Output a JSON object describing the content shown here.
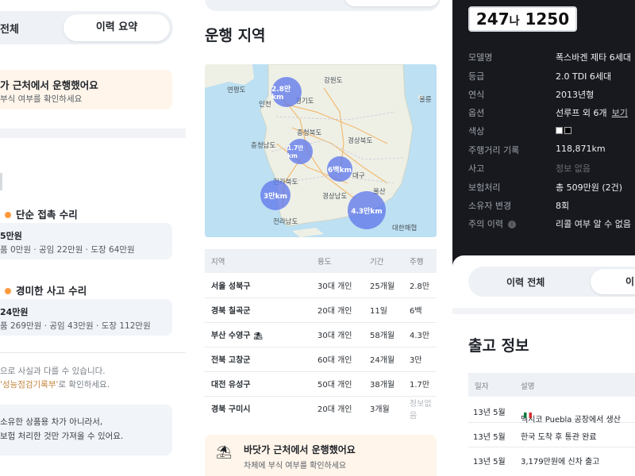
{
  "history_panel": {
    "tab_all": "전체",
    "tab_summary": "이력 요약",
    "notice_title": "가 근처에서 운행했어요",
    "notice_sub": "부식 여부를 확인하세요",
    "repairs": [
      {
        "title": "단순 접촉 수리",
        "amount": "5만원",
        "detail": "품 0만원 · 공임 22만원 · 도장 64만원"
      },
      {
        "title": "경미한 사고 수리",
        "amount": "24만원",
        "detail": "품 269만원 · 공임 43만원 · 도장 112만원"
      }
    ],
    "disclaimer_1": "으로 사실과 다를 수 있습니다.",
    "disclaimer_2_prefix": "",
    "disclaimer_2_link": "'성능점검기록부'",
    "disclaimer_2_suffix": "로 확인하세요.",
    "note_1": "소유한 상품용 차가 아니라서,",
    "note_2": "보험 처리한 것만 가져올 수 있어요."
  },
  "region_panel": {
    "title": "운행 지역",
    "map_labels": [
      "연평도",
      "강원도",
      "인천",
      "경기도",
      "울릉",
      "충청북도",
      "충청남도",
      "경상북도",
      "전라북도",
      "대구",
      "경상남도",
      "울산",
      "전라남도",
      "대한해협"
    ],
    "bubbles": [
      "2.8만km",
      "1.7만km",
      "6백km",
      "3만km",
      "4.3만km"
    ],
    "columns": [
      "지역",
      "용도",
      "기간",
      "주행"
    ],
    "rows": [
      {
        "region": "서울 성북구",
        "use": "30대 개인",
        "period": "25개월",
        "distance": "2.8만"
      },
      {
        "region": "경북 칠곡군",
        "use": "20대 개인",
        "period": "11일",
        "distance": "6백"
      },
      {
        "region": "부산 수영구",
        "use": "30대 개인",
        "period": "58개월",
        "distance": "4.3만"
      },
      {
        "region": "전북 고창군",
        "use": "60대 개인",
        "period": "24개월",
        "distance": "3만"
      },
      {
        "region": "대전 유성구",
        "use": "50대 개인",
        "period": "38개월",
        "distance": "1.7만"
      },
      {
        "region": "경북 구미시",
        "use": "20대 개인",
        "period": "3개월",
        "distance": "정보없음"
      }
    ],
    "notice_title": "바닷가 근처에서 운행했어요",
    "notice_sub": "차체에 부식 여부를 확인하세요"
  },
  "vehicle_panel": {
    "plate_a": "247",
    "plate_b": "나",
    "plate_c": "1250",
    "specs": [
      {
        "label": "모델명",
        "value": "폭스바겐 제타 6세대"
      },
      {
        "label": "등급",
        "value": "2.0 TDI 6세대"
      },
      {
        "label": "연식",
        "value": "2013년형"
      },
      {
        "label": "옵션",
        "value": "선루프 외 6개",
        "link": "보기"
      },
      {
        "label": "색상",
        "value": ""
      },
      {
        "label": "주행거리 기록",
        "value": "118,871km"
      },
      {
        "label": "사고",
        "value": "정보 없음"
      },
      {
        "label": "보험처리",
        "value": "총 509만원 (2건)"
      },
      {
        "label": "소유자 변경",
        "value": "8회"
      },
      {
        "label": "주의 이력",
        "value": "리콜 여부 알 수 없음"
      }
    ],
    "tab_all": "이력 전체",
    "tab_other": "이",
    "release_title": "출고 정보",
    "release_columns": [
      "일자",
      "설명"
    ],
    "release_rows": [
      {
        "date": "13년 5월",
        "desc": "멕시코 Puebla 공장에서 생산"
      },
      {
        "date": "13년 5월",
        "desc": "한국 도착 후 통관 완료"
      },
      {
        "date": "13년 5월",
        "desc": "3,179만원에 신차 출고"
      }
    ],
    "colors": {
      "swatch_white": "#ffffff",
      "swatch_black": "#000000"
    }
  }
}
